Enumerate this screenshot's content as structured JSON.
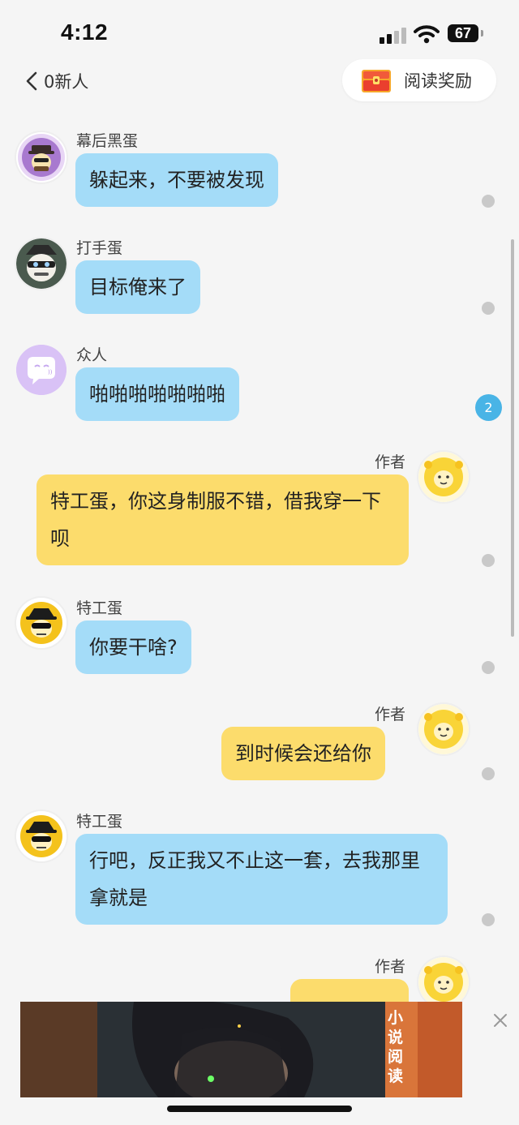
{
  "status_bar": {
    "time": "4:12",
    "battery": "67"
  },
  "nav": {
    "back_label": "0新人",
    "reward_label": "阅读奖励"
  },
  "messages": [
    {
      "speaker": "幕后黑蛋",
      "text": "躲起来，不要被发现"
    },
    {
      "speaker": "打手蛋",
      "text": "目标俺来了"
    },
    {
      "speaker": "众人",
      "text": "啪啪啪啪啪啪啪"
    },
    {
      "speaker": "作者",
      "text": "特工蛋，你这身制服不错，借我穿一下呗"
    },
    {
      "speaker": "特工蛋",
      "text": "你要干啥?"
    },
    {
      "speaker": "作者",
      "text": "到时候会还给你"
    },
    {
      "speaker": "特工蛋",
      "text": "行吧，反正我又不止这一套，去我那里拿就是"
    },
    {
      "speaker": "作者",
      "text": ""
    }
  ],
  "comment_badge": "2",
  "ad": {
    "label": "小说阅读"
  },
  "colors": {
    "blue_bubble": "#a4dcf8",
    "yellow_bubble": "#fcdc6c",
    "background": "#f5f5f5"
  }
}
